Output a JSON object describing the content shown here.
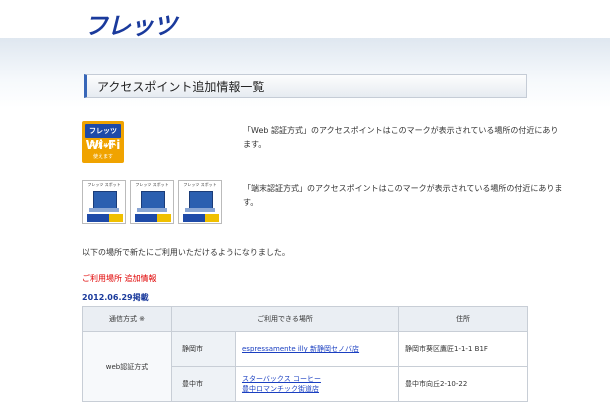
{
  "header": {
    "logo_text": "フレッツ"
  },
  "page": {
    "title": "アクセスポイント追加情報一覧"
  },
  "wifi_badge": {
    "top": "フレッツ スポット",
    "main": "Wi-Fi",
    "bottom": "使えます"
  },
  "web_auth": {
    "desc": "「Web 認証方式」のアクセスポイントはこのマークが表示されている場所の付近にあります。"
  },
  "terminal_auth": {
    "desc": "「端末認証方式」のアクセスポイントはこのマークが表示されている場所の付近にあります。",
    "marks": [
      {
        "caption": "フレッツ スポット"
      },
      {
        "caption": "フレッツ スポット"
      },
      {
        "caption": "フレッツ スポット"
      }
    ]
  },
  "intro_text": "以下の場所で新たにご利用いただけるようになりました。",
  "section_heading": "ご利用場所 追加情報",
  "posted_date": "2012.06.29掲載",
  "table": {
    "headers": [
      "通信方式 ※",
      "ご利用できる場所",
      "住所"
    ],
    "method": "web認証方式",
    "rows": [
      {
        "city": "静岡市",
        "places": [
          "espressamente illy 新静岡セノバ店"
        ],
        "address": "静岡市葵区鷹匠1-1-1 B1F"
      },
      {
        "city": "豊中市",
        "places": [
          "スターバックス コーヒー",
          "豊中ロマンチック街道店"
        ],
        "address": "豊中市向丘2-10-22"
      }
    ]
  }
}
